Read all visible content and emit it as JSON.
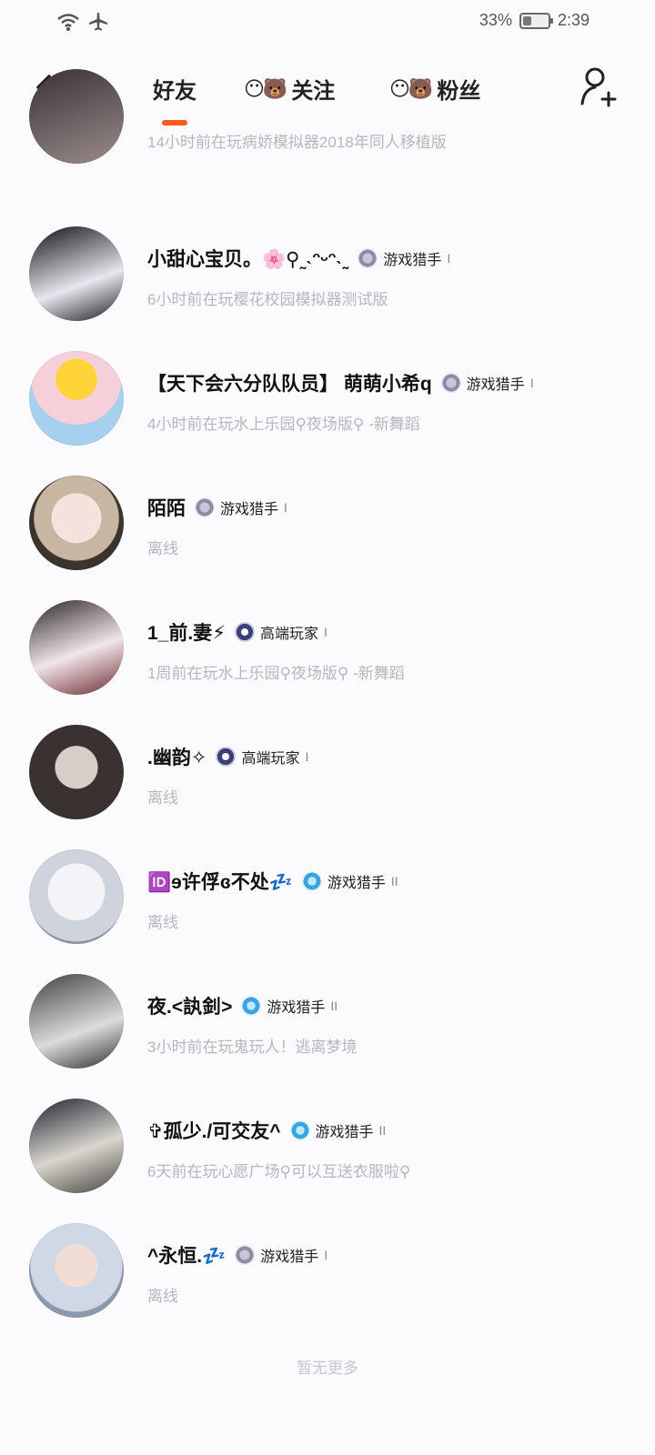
{
  "status_bar": {
    "battery_percent": "33%",
    "battery_level": 0.33,
    "time": "2:39",
    "icons": [
      "wifi-icon",
      "airplane-icon",
      "battery-leaf-icon"
    ]
  },
  "header": {
    "tabs": [
      {
        "label": "好友",
        "active": true
      },
      {
        "label": "关注",
        "icon": "bear-pair-icon"
      },
      {
        "label": "粉丝",
        "icon": "bear-pair-icon"
      }
    ],
    "accent_color": "#ff5a1f"
  },
  "friends": [
    {
      "name": "",
      "badge": "",
      "status": "14小时前在玩病娇模拟器2018年同人移植版"
    },
    {
      "name": "小甜心宝贝。🌸⚲˷˴ᵔᵕᵔ˴˷",
      "badge": "游戏猎手",
      "badge_level": "I",
      "status": "6小时前在玩樱花校园模拟器测试版"
    },
    {
      "name": "【天下会六分队队员】 萌萌小希q",
      "badge": "游戏猎手",
      "badge_level": "I",
      "status": "4小时前在玩水上乐园⚲夜场版⚲ -新舞蹈"
    },
    {
      "name": "陌陌",
      "badge": "游戏猎手",
      "badge_level": "I",
      "status": "离线"
    },
    {
      "name": "1_前.妻⚡",
      "badge": "高端玩家",
      "badge_level": "I",
      "status": "1周前在玩水上乐园⚲夜场版⚲ -新舞蹈"
    },
    {
      "name": ".幽韵✧",
      "badge": "高端玩家",
      "badge_level": "I",
      "status": "离线"
    },
    {
      "name": "🆔ɘ许俘ɞ不处💤",
      "badge": "游戏猎手",
      "badge_level": "II",
      "status": "离线"
    },
    {
      "name": "夜.<訙釗>",
      "badge": "游戏猎手",
      "badge_level": "II",
      "status": "3小时前在玩鬼玩人！逃离梦境"
    },
    {
      "name": "✞孤少./可交友^",
      "badge": "游戏猎手",
      "badge_level": "II",
      "status": "6天前在玩心愿广场⚲可以互送衣服啦⚲"
    },
    {
      "name": "^永恒.💤",
      "badge": "游戏猎手",
      "badge_level": "I",
      "status": "离线"
    }
  ],
  "footer": {
    "no_more": "暂无更多"
  }
}
